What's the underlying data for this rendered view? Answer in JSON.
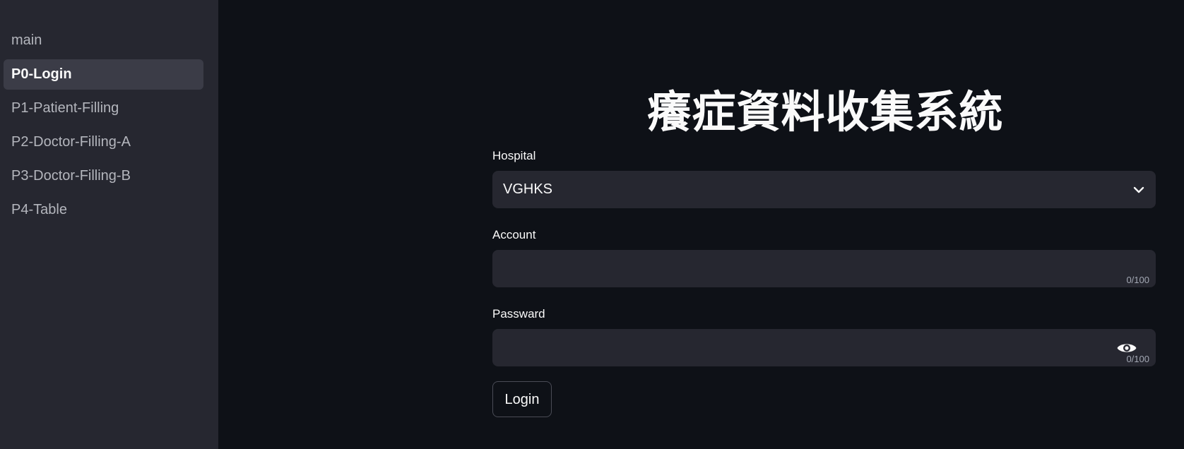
{
  "sidebar": {
    "items": [
      {
        "label": "main"
      },
      {
        "label": "P0-Login"
      },
      {
        "label": "P1-Patient-Filling"
      },
      {
        "label": "P2-Doctor-Filling-A"
      },
      {
        "label": "P3-Doctor-Filling-B"
      },
      {
        "label": "P4-Table"
      }
    ],
    "active_item": "P0-Login"
  },
  "main": {
    "title": "癢症資料收集系統",
    "hospital": {
      "label": "Hospital",
      "selected": "VGHKS"
    },
    "account": {
      "label": "Account",
      "value": "",
      "counter": "0/100"
    },
    "password": {
      "label": "Passward",
      "value": "",
      "counter": "0/100"
    },
    "login_label": "Login"
  },
  "colors": {
    "background": "#0e1117",
    "sidebar": "#262730",
    "input": "#262730",
    "active_nav": "#3b3c47",
    "text": "#fafafa"
  },
  "icons": {
    "dropdown": "chevron-down-icon",
    "password_toggle": "eye-icon"
  }
}
